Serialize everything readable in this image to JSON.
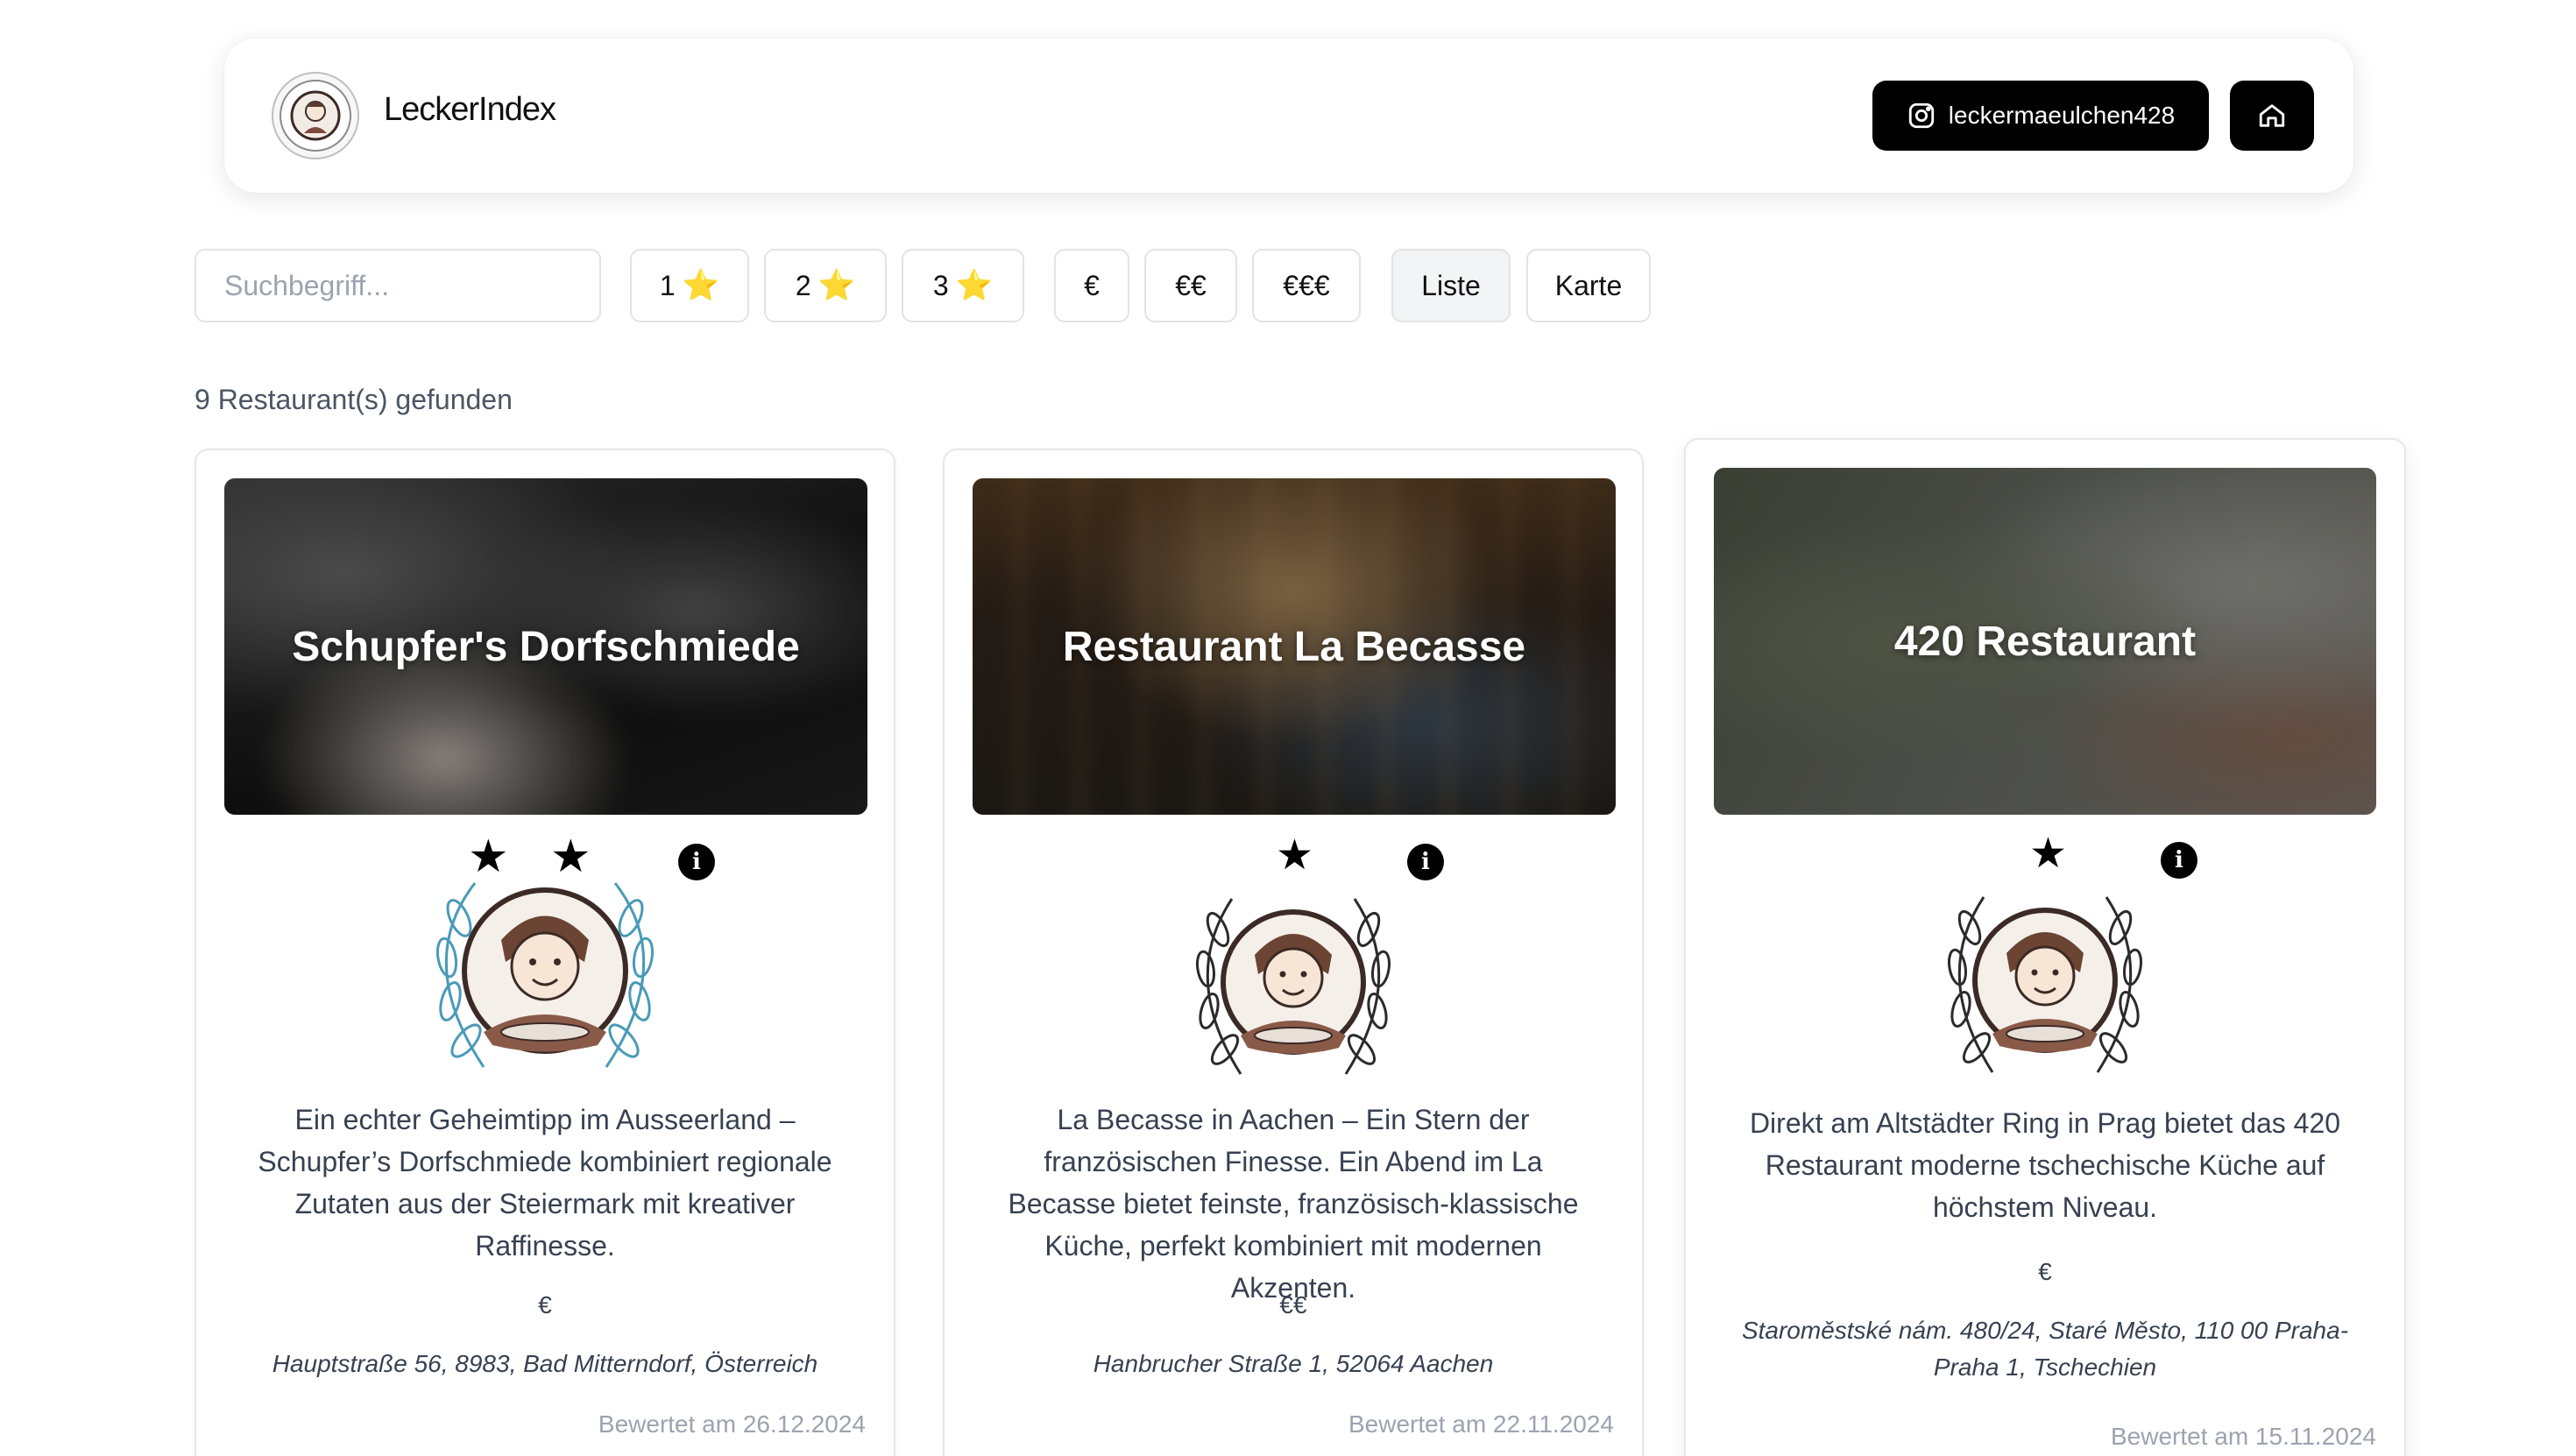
{
  "header": {
    "brand": "LeckerIndex",
    "instagram_label": "leckermaeulchen428"
  },
  "filters": {
    "search_placeholder": "Suchbegriff...",
    "stars": [
      "1",
      "2",
      "3"
    ],
    "star_emoji": "⭐",
    "prices": [
      "€",
      "€€",
      "€€€"
    ],
    "view_list": "Liste",
    "view_map": "Karte",
    "active_view": "Liste"
  },
  "result_count": "9 Restaurant(s) gefunden",
  "restaurants": [
    {
      "name": "Schupfer's Dorfschmiede",
      "stars": 2,
      "description": "Ein echter Geheimtipp im Ausseerland – Schupfer’s Dorfschmiede kombiniert regionale Zutaten aus der Steiermark mit kreativer Raffinesse.",
      "price": "€",
      "address": "Hauptstraße 56, 8983, Bad Mitterndorf, Österreich",
      "rated": "Bewertet am 26.12.2024",
      "laurel_color": "#4a9ab8"
    },
    {
      "name": "Restaurant La Becasse",
      "stars": 1,
      "description": "La Becasse in Aachen – Ein Stern der französischen Finesse. Ein Abend im La Becasse bietet feinste, französisch-klassische Küche, perfekt kombiniert mit modernen Akzenten.",
      "price": "€€",
      "address": "Hanbrucher Straße 1, 52064 Aachen",
      "rated": "Bewertet am 22.11.2024",
      "laurel_color": "#2b2b2b"
    },
    {
      "name": "420 Restaurant",
      "stars": 1,
      "description": "Direkt am Altstädter Ring in Prag bietet das 420 Restaurant moderne tschechische Küche auf höchstem Niveau.",
      "price": "€",
      "address": "Staroměstské nám. 480/24, Staré Město, 110 00 Praha-Praha 1, Tschechien",
      "rated": "Bewertet am 15.11.2024",
      "laurel_color": "#2b2b2b"
    }
  ],
  "info_glyph": "i",
  "star_glyph": "★"
}
